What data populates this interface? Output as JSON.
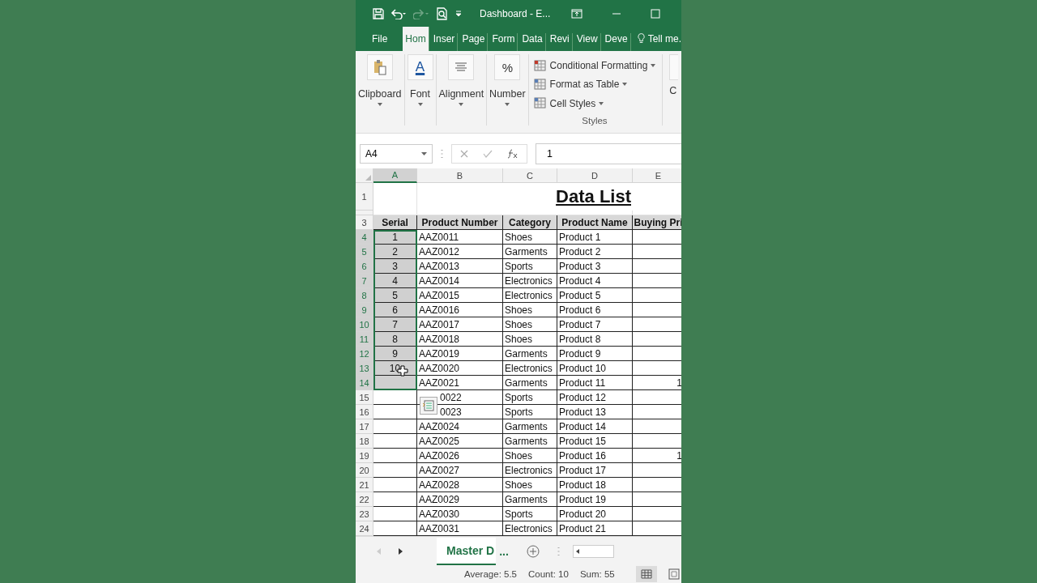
{
  "window": {
    "title": "Dashboard - E..."
  },
  "tabs": [
    {
      "label": "File",
      "selected": false
    },
    {
      "label": "Hom",
      "selected": true
    },
    {
      "label": "Inser",
      "selected": false
    },
    {
      "label": "Page",
      "selected": false
    },
    {
      "label": "Form",
      "selected": false
    },
    {
      "label": "Data",
      "selected": false
    },
    {
      "label": "Revi",
      "selected": false
    },
    {
      "label": "View",
      "selected": false
    },
    {
      "label": "Deve",
      "selected": false
    }
  ],
  "tell_me": "Tell me.",
  "ribbon": {
    "groups": [
      {
        "kind": "clipboard",
        "label": "Clipboard"
      },
      {
        "kind": "font",
        "label": "Font",
        "glyph": "A"
      },
      {
        "kind": "alignment",
        "label": "Alignment"
      },
      {
        "kind": "number",
        "label": "Number",
        "glyph": "%"
      }
    ],
    "styles": {
      "items": [
        "Conditional Formatting",
        "Format as Table",
        "Cell Styles"
      ],
      "label": "Styles"
    },
    "cut_group": "C"
  },
  "formula_bar": {
    "name_box": "A4",
    "value": "1"
  },
  "columns": [
    {
      "label": "A",
      "selected": true
    },
    {
      "label": "B",
      "selected": false
    },
    {
      "label": "C",
      "selected": false
    },
    {
      "label": "D",
      "selected": false
    },
    {
      "label": "E",
      "selected": false
    }
  ],
  "title_row": {
    "row": "1",
    "text": "Data List"
  },
  "header_row": {
    "row": "3",
    "cells": [
      "Serial",
      "Product Number",
      "Category",
      "Product Name",
      "Buying Pri"
    ]
  },
  "rows": [
    {
      "row": "4",
      "serial": "1",
      "product_number": "AAZ0011",
      "category": "Shoes",
      "product_name": "Product 1",
      "selected": true
    },
    {
      "row": "5",
      "serial": "2",
      "product_number": "AAZ0012",
      "category": "Garments",
      "product_name": "Product 2",
      "selected": true
    },
    {
      "row": "6",
      "serial": "3",
      "product_number": "AAZ0013",
      "category": "Sports",
      "product_name": "Product 3",
      "selected": true
    },
    {
      "row": "7",
      "serial": "4",
      "product_number": "AAZ0014",
      "category": "Electronics",
      "product_name": "Product 4",
      "selected": true
    },
    {
      "row": "8",
      "serial": "5",
      "product_number": "AAZ0015",
      "category": "Electronics",
      "product_name": "Product 5",
      "selected": true
    },
    {
      "row": "9",
      "serial": "6",
      "product_number": "AAZ0016",
      "category": "Shoes",
      "product_name": "Product 6",
      "selected": true
    },
    {
      "row": "10",
      "serial": "7",
      "product_number": "AAZ0017",
      "category": "Shoes",
      "product_name": "Product 7",
      "selected": true
    },
    {
      "row": "11",
      "serial": "8",
      "product_number": "AAZ0018",
      "category": "Shoes",
      "product_name": "Product 8",
      "selected": true
    },
    {
      "row": "12",
      "serial": "9",
      "product_number": "AAZ0019",
      "category": "Garments",
      "product_name": "Product 9",
      "selected": true
    },
    {
      "row": "13",
      "serial": "10",
      "product_number": "AAZ0020",
      "category": "Electronics",
      "product_name": "Product 10",
      "selected": true
    },
    {
      "row": "14",
      "product_number": "AAZ0021",
      "category": "Garments",
      "product_name": "Product 11",
      "column_e": "1",
      "selected": true
    },
    {
      "row": "15",
      "product_number": "0022",
      "category": "Sports",
      "product_name": "Product 12",
      "selected": false
    },
    {
      "row": "16",
      "product_number": "0023",
      "category": "Sports",
      "product_name": "Product 13",
      "selected": false
    },
    {
      "row": "17",
      "product_number": "AAZ0024",
      "category": "Garments",
      "product_name": "Product 14",
      "selected": false
    },
    {
      "row": "18",
      "product_number": "AAZ0025",
      "category": "Garments",
      "product_name": "Product 15",
      "selected": false
    },
    {
      "row": "19",
      "product_number": "AAZ0026",
      "category": "Shoes",
      "product_name": "Product 16",
      "column_e": "1",
      "selected": false
    },
    {
      "row": "20",
      "product_number": "AAZ0027",
      "category": "Electronics",
      "product_name": "Product 17",
      "selected": false
    },
    {
      "row": "21",
      "product_number": "AAZ0028",
      "category": "Shoes",
      "product_name": "Product 18",
      "selected": false
    },
    {
      "row": "22",
      "product_number": "AAZ0029",
      "category": "Garments",
      "product_name": "Product 19",
      "selected": false
    },
    {
      "row": "23",
      "product_number": "AAZ0030",
      "category": "Sports",
      "product_name": "Product 20",
      "selected": false
    },
    {
      "row": "24",
      "product_number": "AAZ0031",
      "category": "Electronics",
      "product_name": "Product 21",
      "selected": false
    }
  ],
  "sheet_tabs": [
    {
      "label": "Master D",
      "selected": true
    }
  ],
  "sheet_more": "...",
  "status_bar": [
    "Average: 5.5",
    "Count: 10",
    "Sum: 55"
  ]
}
